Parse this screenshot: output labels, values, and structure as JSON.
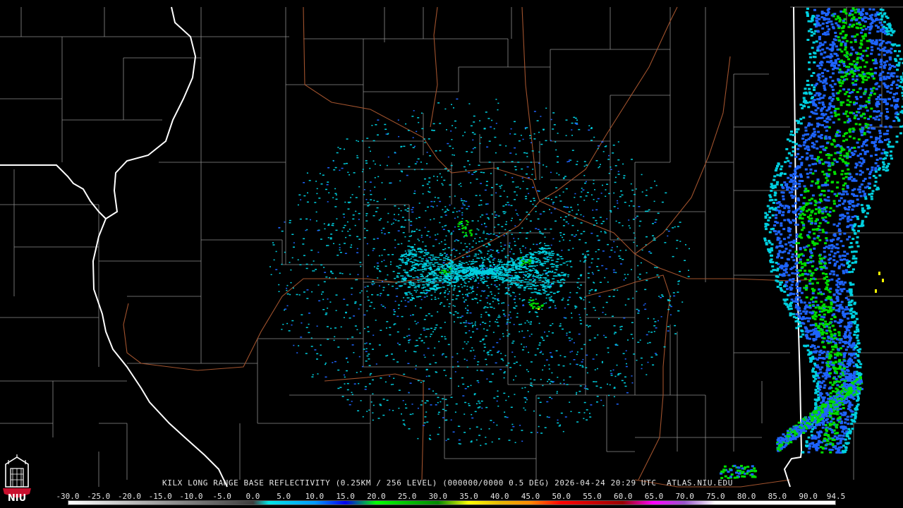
{
  "product": {
    "caption": "KILX LONG RANGE BASE REFLECTIVITY (0.25KM / 256 LEVEL) (000000/0000 0.5 DEG) 2026-04-24 20:29 UTC  ATLAS.NIU.EDU",
    "radar_site": "KILX"
  },
  "colorbar": {
    "labels": [
      "-30.0",
      "-25.0",
      "-20.0",
      "-15.0",
      "-10.0",
      "-5.0",
      "0.0",
      "5.0",
      "10.0",
      "15.0",
      "20.0",
      "25.0",
      "30.0",
      "35.0",
      "40.0",
      "45.0",
      "50.0",
      "55.0",
      "60.0",
      "65.0",
      "70.0",
      "75.0",
      "80.0",
      "85.0",
      "90.0",
      "94.5"
    ],
    "min": -30.0,
    "max": 94.5,
    "stops": [
      {
        "v": -30,
        "c": "#ffffff"
      },
      {
        "v": 0,
        "c": "#3c3c3c"
      },
      {
        "v": 2.5,
        "c": "#00e5e5"
      },
      {
        "v": 10,
        "c": "#0099ff"
      },
      {
        "v": 15,
        "c": "#0000ee"
      },
      {
        "v": 20,
        "c": "#00ff00"
      },
      {
        "v": 25,
        "c": "#00c000"
      },
      {
        "v": 30,
        "c": "#008800"
      },
      {
        "v": 35,
        "c": "#ffff00"
      },
      {
        "v": 40,
        "c": "#e6b800"
      },
      {
        "v": 45,
        "c": "#ff8800"
      },
      {
        "v": 50,
        "c": "#ff0000"
      },
      {
        "v": 55,
        "c": "#cc0000"
      },
      {
        "v": 60,
        "c": "#990000"
      },
      {
        "v": 65,
        "c": "#ff00ff"
      },
      {
        "v": 70,
        "c": "#9955cc"
      },
      {
        "v": 75,
        "c": "#ffffff"
      },
      {
        "v": 94.5,
        "c": "#ffffff"
      }
    ]
  },
  "logo": {
    "text": "NIU",
    "color": "#c8102e"
  },
  "map_colors": {
    "background": "#000000",
    "county_border": "#8c8c8c",
    "state_border": "#ffffff",
    "highway": "#a0522d",
    "echo_light": "#00d0e0",
    "echo_blue": "#1e64ff",
    "echo_green": "#00dd00",
    "echo_yellow": "#ffff00"
  }
}
